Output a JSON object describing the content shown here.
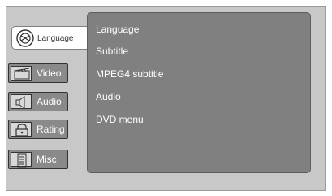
{
  "tabs": [
    {
      "label": "Language",
      "icon": "globe-icon",
      "active": true
    },
    {
      "label": "Video",
      "icon": "clapperboard-icon",
      "active": false
    },
    {
      "label": "Audio",
      "icon": "speaker-icon",
      "active": false
    },
    {
      "label": "Rating",
      "icon": "lock-icon",
      "active": false
    },
    {
      "label": "Misc",
      "icon": "document-icon",
      "active": false
    }
  ],
  "menu": {
    "items": [
      "Language",
      "Subtitle",
      "MPEG4 subtitle",
      "Audio",
      "DVD menu"
    ]
  },
  "colors": {
    "frame": "#c8c8c8",
    "panel": "#808080",
    "tab": "#8a8a8a",
    "active_tab": "#ffffff",
    "text": "#ffffff"
  }
}
